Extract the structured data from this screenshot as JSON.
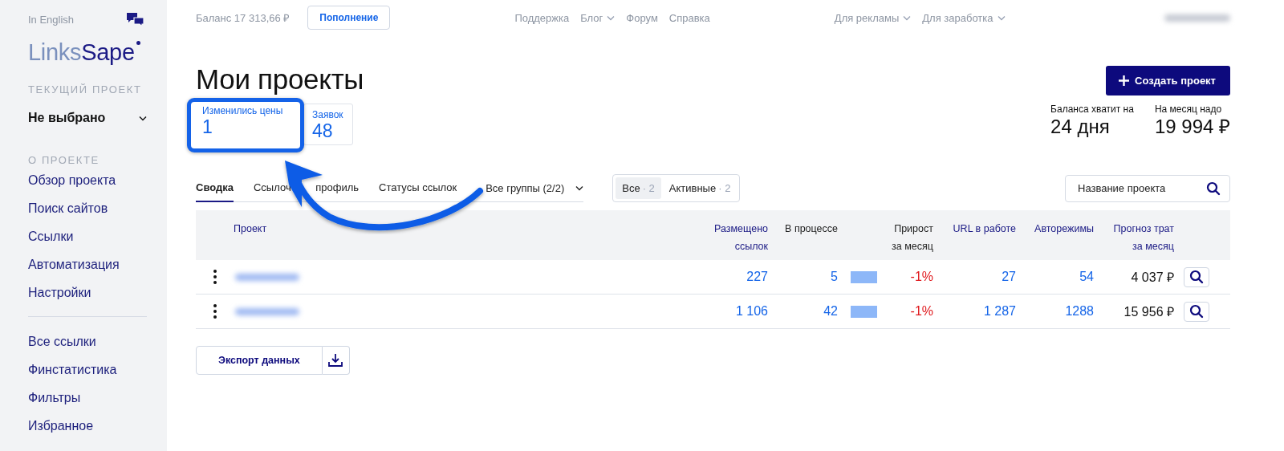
{
  "sidebar": {
    "language_link": "In English",
    "logo": {
      "part_1": "Links",
      "part_2": "Sape"
    },
    "current_project_heading": "ТЕКУЩИЙ ПРОЕКТ",
    "current_project": "Не выбрано",
    "sections": [
      {
        "heading": "О ПРОЕКТЕ",
        "items": [
          "Обзор проекта",
          "Поиск сайтов",
          "Ссылки",
          "Автоматизация",
          "Настройки"
        ]
      },
      {
        "items": [
          "Все ссылки",
          "Финстатистика",
          "Фильтры",
          "Избранное"
        ]
      }
    ]
  },
  "top_bar": {
    "balance": "Баланс 17 313,66 ₽",
    "top_up_button": "Пополнение",
    "nav_links": [
      {
        "label": "Поддержка",
        "has_menu": false
      },
      {
        "label": "Блог",
        "has_menu": true
      },
      {
        "label": "Форум",
        "has_menu": false
      },
      {
        "label": "Справка",
        "has_menu": false
      }
    ],
    "business_links": [
      {
        "label": "Для рекламы",
        "has_menu": true
      },
      {
        "label": "Для заработка",
        "has_menu": true
      }
    ]
  },
  "page": {
    "title": "Мои проекты",
    "create_button": "Создать проект",
    "counters": [
      {
        "label": "Изменились цены",
        "value": "1",
        "highlighted": true
      },
      {
        "label": "Заявок",
        "value": "48",
        "highlighted": false
      }
    ],
    "forecast": [
      {
        "label": "Баланса хватит на",
        "value": "24 дня"
      },
      {
        "label": "На месяц надо",
        "value": "19 994 ₽"
      }
    ],
    "tabs": [
      {
        "label": "Сводка",
        "selected": true
      },
      {
        "label": "Ссылоч профиль",
        "selected": false
      },
      {
        "label": "Статусы ссылок",
        "selected": false
      }
    ],
    "group_filter": "Все группы (2/2)",
    "status_filter": [
      {
        "label": "Все",
        "count": "· 2",
        "selected": true
      },
      {
        "label": "Активные",
        "count": "· 2",
        "selected": false
      }
    ],
    "search": {
      "placeholder": "Название проекта"
    },
    "table": {
      "columns": [
        {
          "label": "Проект",
          "sortable": true
        },
        {
          "label": "Размещено ссылок",
          "sortable": true
        },
        {
          "label": "В процессе",
          "sortable": false
        },
        {
          "label": "Прирост за месяц",
          "sortable": false
        },
        {
          "label": "URL в работе",
          "sortable": true
        },
        {
          "label": "Авторежимы",
          "sortable": true
        },
        {
          "label": "Прогноз трат за месяц",
          "sortable": true
        }
      ],
      "rows": [
        {
          "cells": [
            {
              "kind": "redacted"
            },
            {
              "kind": "link",
              "text": "227"
            },
            {
              "kind": "link_bar",
              "text": "5"
            },
            {
              "kind": "negative",
              "text": "-1%"
            },
            {
              "kind": "link",
              "text": "27"
            },
            {
              "kind": "link",
              "text": "54"
            },
            {
              "kind": "text",
              "text": "4 037 ₽"
            }
          ]
        },
        {
          "cells": [
            {
              "kind": "redacted"
            },
            {
              "kind": "link",
              "text": "1 106"
            },
            {
              "kind": "link_bar",
              "text": "42"
            },
            {
              "kind": "negative",
              "text": "-1%"
            },
            {
              "kind": "link",
              "text": "1 287"
            },
            {
              "kind": "link",
              "text": "1288"
            },
            {
              "kind": "text",
              "text": "15 956 ₽"
            }
          ]
        }
      ]
    },
    "export_button": "Экспорт данных"
  }
}
